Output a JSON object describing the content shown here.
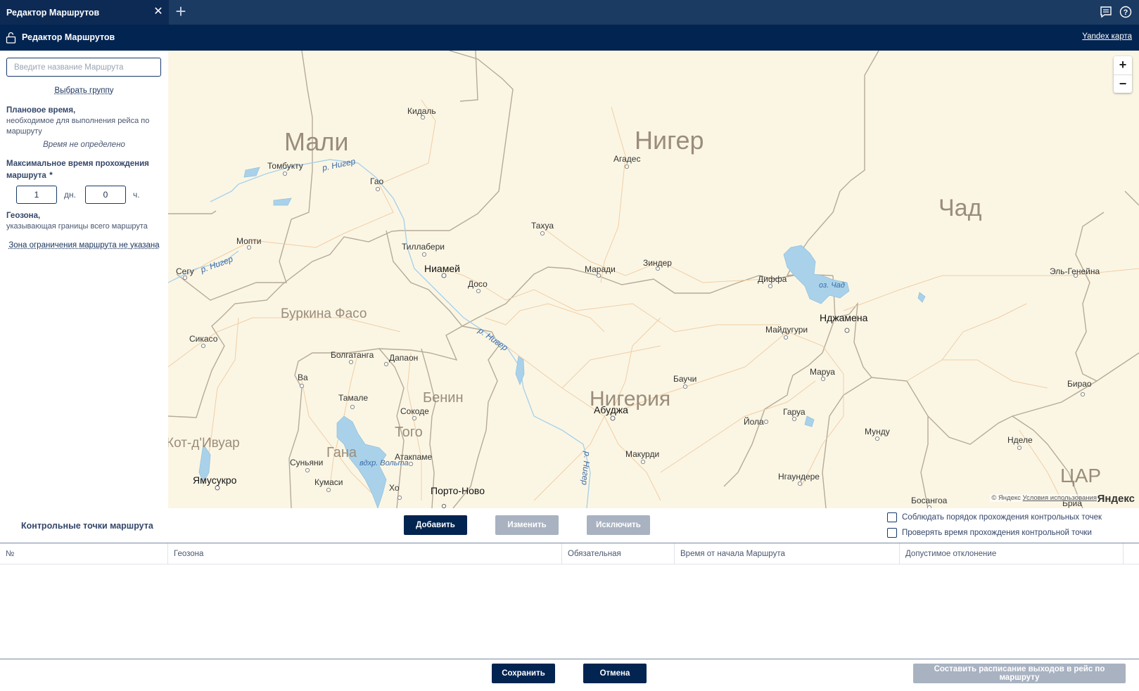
{
  "tab": {
    "title": "Редактор Маршрутов",
    "close": "✕",
    "add": "+"
  },
  "header": {
    "title": "Редактор Маршрутов",
    "map_link": "Yandex карта"
  },
  "sidebar": {
    "route_name_placeholder": "Введите название Маршрута",
    "choose_group": "Выбрать группу",
    "planned_time_label": "Плановое время,",
    "planned_time_desc": "необходимое для выполнения рейса по маршруту",
    "planned_time_value": "Время не определено",
    "max_time_label": "Максимальное время прохождения маршрута",
    "max_time_required": "*",
    "days_value": "1",
    "days_unit": "дн.",
    "hours_value": "0",
    "hours_unit": "ч.",
    "geozone_label": "Геозона,",
    "geozone_desc": "указывающая границы всего маршрута",
    "zone_link": "Зона ограничения маршрута не указана"
  },
  "map": {
    "zoom_in": "+",
    "zoom_out": "−",
    "copyright": "© Яндекс",
    "terms": "Условия использования",
    "logo": "Яндекс",
    "countries": [
      "Мали",
      "Нигер",
      "Чад",
      "Буркина Фасо",
      "Бенин",
      "Нигерия",
      "Гана",
      "Того",
      "Кот-д'Ивуар",
      "ЦАР"
    ],
    "cities": [
      "Кидаль",
      "Томбукту",
      "Гао",
      "Агадес",
      "Тахуа",
      "Тиллабери",
      "Ниамей",
      "Досо",
      "Маради",
      "Зиндер",
      "Диффа",
      "Нджамена",
      "Майдугури",
      "Мопти",
      "Сегу",
      "Сикасо",
      "Болгатанга",
      "Дапаон",
      "Ва",
      "Тамале",
      "Сокоде",
      "Атакпаме",
      "Суньяни",
      "Кумаси",
      "Хо",
      "Порто-Ново",
      "Ямусукро",
      "Абуджа",
      "Баучи",
      "Макурди",
      "Йола",
      "Гаруа",
      "Маруа",
      "Мунду",
      "Нгаундере",
      "Босангоа",
      "Бирао",
      "Нделе",
      "Эль-Генейна",
      "Бриа"
    ],
    "water_labels": [
      "р. Нигер",
      "р. Нигер",
      "р. Нигер",
      "р. Нигер",
      "оз. Чад",
      "вдхр. Вольта"
    ]
  },
  "checkpoints": {
    "title": "Контрольные точки маршрута",
    "add": "Добавить",
    "edit": "Изменить",
    "exclude": "Исключить",
    "order_check": "Соблюдать порядок прохождения контрольных точек",
    "time_check": "Проверять время прохождения контрольной точки"
  },
  "table": {
    "columns": [
      "№",
      "Геозона",
      "Обязательная",
      "Время от начала Маршрута",
      "Допустимое отклонение"
    ],
    "rows": []
  },
  "footer": {
    "save": "Сохранить",
    "cancel": "Отмена",
    "schedule": "Составить расписание выходов в рейс по маршруту"
  },
  "colors": {
    "tab_bg": "#1c3b63",
    "header_bg": "#022451",
    "primary_button": "#022451",
    "disabled_button": "#a8b2c1",
    "map_land": "#fbf6e4",
    "map_water": "#a9d2ea"
  }
}
